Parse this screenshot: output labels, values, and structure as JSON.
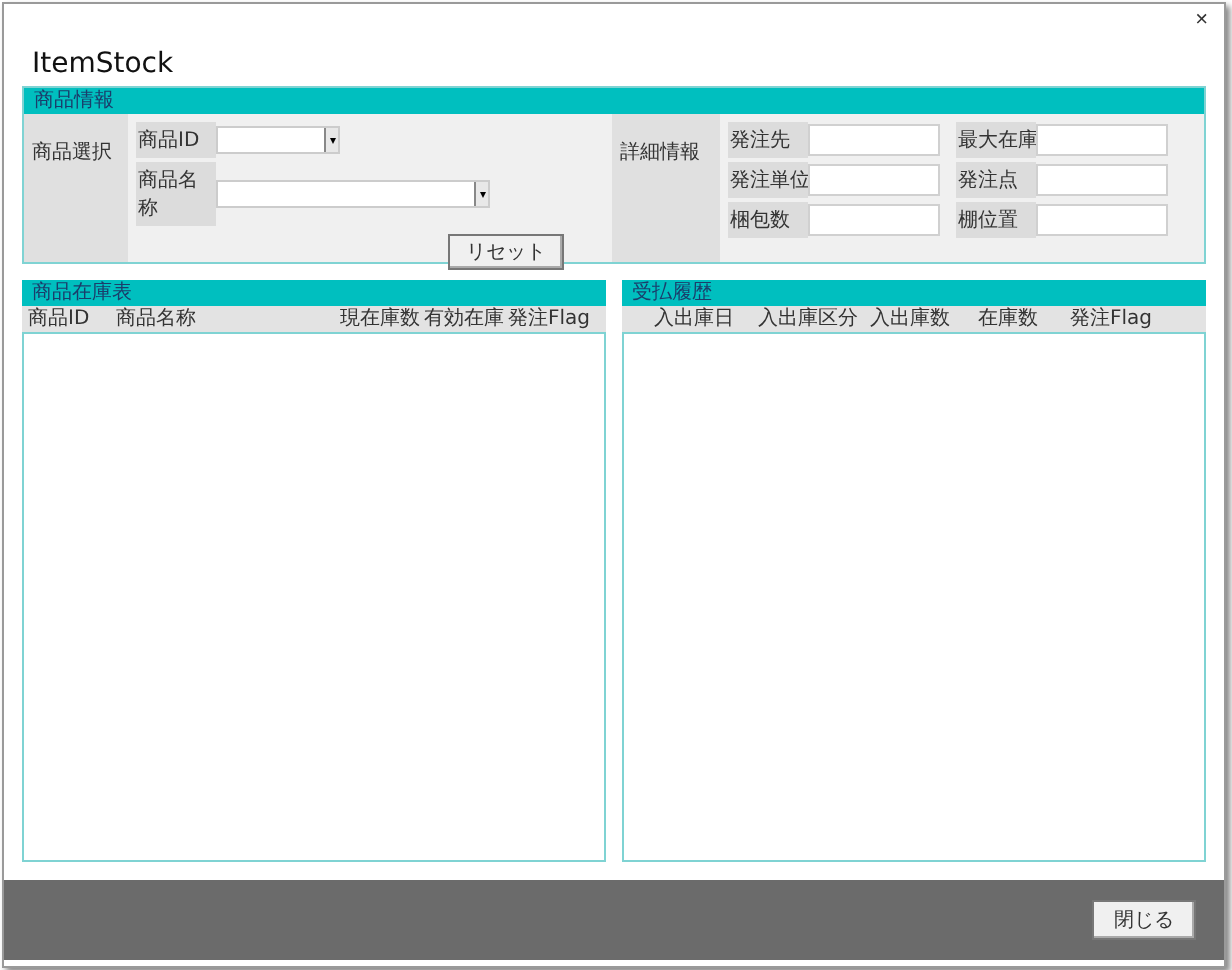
{
  "window": {
    "title": "ItemStock",
    "close": "×"
  },
  "item_info": {
    "title": "商品情報",
    "selection_label": "商品選択",
    "fields": [
      {
        "label": "商品ID"
      },
      {
        "label": "商品名称"
      }
    ],
    "reset_button": "リセット",
    "detail_label": "詳細情報",
    "detail_fields": [
      {
        "label": "発注先"
      },
      {
        "label": "最大在庫"
      },
      {
        "label": "発注単位"
      },
      {
        "label": "発注点"
      },
      {
        "label": "梱包数"
      },
      {
        "label": "棚位置"
      }
    ]
  },
  "stock_table": {
    "title": "商品在庫表",
    "columns": [
      "商品ID",
      "商品名称",
      "現在庫数",
      "有効在庫",
      "発注Flag"
    ]
  },
  "history_table": {
    "title": "受払履歴",
    "columns": [
      "入出庫日",
      "入出庫区分",
      "入出庫数",
      "在庫数",
      "発注Flag"
    ]
  },
  "footer": {
    "close_button": "閉じる"
  }
}
